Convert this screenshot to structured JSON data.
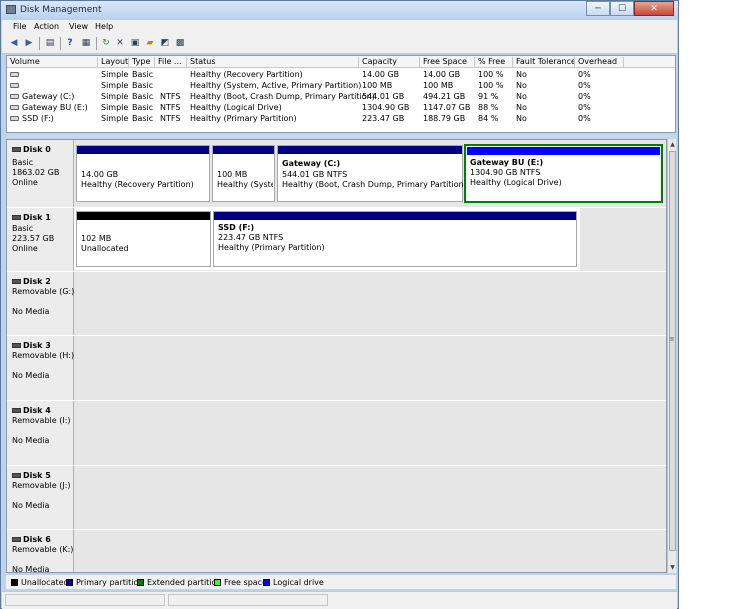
{
  "window": {
    "title": "Disk Management",
    "min_label": "─",
    "max_label": "☐",
    "close_label": "✕"
  },
  "menu": [
    "File",
    "Action",
    "View",
    "Help"
  ],
  "toolbar": {
    "icons": [
      "back-arrow-icon",
      "forward-arrow-icon",
      "console-tree-icon",
      "help-icon",
      "properties-icon",
      "refresh-icon",
      "delete-icon",
      "rescan-icon",
      "open-folder-icon",
      "explore-icon",
      "settings-icon"
    ]
  },
  "volume_columns": [
    "Volume",
    "Layout",
    "Type",
    "File ...",
    "Status",
    "Capacity",
    "Free Space",
    "% Free",
    "Fault Tolerance",
    "Overhead"
  ],
  "volumes": [
    [
      "",
      "Simple",
      "Basic",
      "",
      "Healthy (Recovery Partition)",
      "14.00 GB",
      "14.00 GB",
      "100 %",
      "No",
      "0%"
    ],
    [
      "",
      "Simple",
      "Basic",
      "",
      "Healthy (System, Active, Primary Partition)",
      "100 MB",
      "100 MB",
      "100 %",
      "No",
      "0%"
    ],
    [
      "Gateway (C:)",
      "Simple",
      "Basic",
      "NTFS",
      "Healthy (Boot, Crash Dump, Primary Partition)",
      "544.01 GB",
      "494.21 GB",
      "91 %",
      "No",
      "0%"
    ],
    [
      "Gateway BU (E:)",
      "Simple",
      "Basic",
      "NTFS",
      "Healthy (Logical Drive)",
      "1304.90 GB",
      "1147.07 GB",
      "88 %",
      "No",
      "0%"
    ],
    [
      "SSD (F:)",
      "Simple",
      "Basic",
      "NTFS",
      "Healthy (Primary Partition)",
      "223.47 GB",
      "188.79 GB",
      "84 %",
      "No",
      "0%"
    ]
  ],
  "disk0": {
    "name": "Disk 0",
    "type": "Basic",
    "size": "1863.02 GB",
    "state": "Online",
    "p1": {
      "size": "14.00 GB",
      "status": "Healthy (Recovery Partition)"
    },
    "p2": {
      "size": "100 MB",
      "status": "Healthy (System"
    },
    "p3": {
      "title": "Gateway  (C:)",
      "size": "544.01 GB NTFS",
      "status": "Healthy (Boot, Crash Dump, Primary Partition)"
    },
    "p4": {
      "title": "Gateway BU  (E:)",
      "size": "1304.90 GB NTFS",
      "status": "Healthy (Logical Drive)"
    }
  },
  "disk1": {
    "name": "Disk 1",
    "type": "Basic",
    "size": "223.57 GB",
    "state": "Online",
    "p1": {
      "size": "102 MB",
      "status": "Unallocated"
    },
    "p2": {
      "title": "SSD  (F:)",
      "size": "223.47 GB NTFS",
      "status": "Healthy (Primary Partition)"
    }
  },
  "removable": [
    {
      "name": "Disk 2",
      "type": "Removable (G:)",
      "state": "No Media"
    },
    {
      "name": "Disk 3",
      "type": "Removable (H:)",
      "state": "No Media"
    },
    {
      "name": "Disk 4",
      "type": "Removable (I:)",
      "state": "No Media"
    },
    {
      "name": "Disk 5",
      "type": "Removable (J:)",
      "state": "No Media"
    },
    {
      "name": "Disk 6",
      "type": "Removable (K:)",
      "state": "No Media"
    }
  ],
  "legend": [
    {
      "label": "Unallocated",
      "color": "#000000"
    },
    {
      "label": "Primary partition",
      "color": "#000080"
    },
    {
      "label": "Extended partition",
      "color": "#008000"
    },
    {
      "label": "Free space",
      "color": "#33ff33"
    },
    {
      "label": "Logical drive",
      "color": "#0000ff"
    }
  ],
  "colors": {
    "primary_bar": "#000080",
    "unallocated_bar": "#000000",
    "logical_bar": "#0000ff",
    "extended_border": "#008000"
  }
}
